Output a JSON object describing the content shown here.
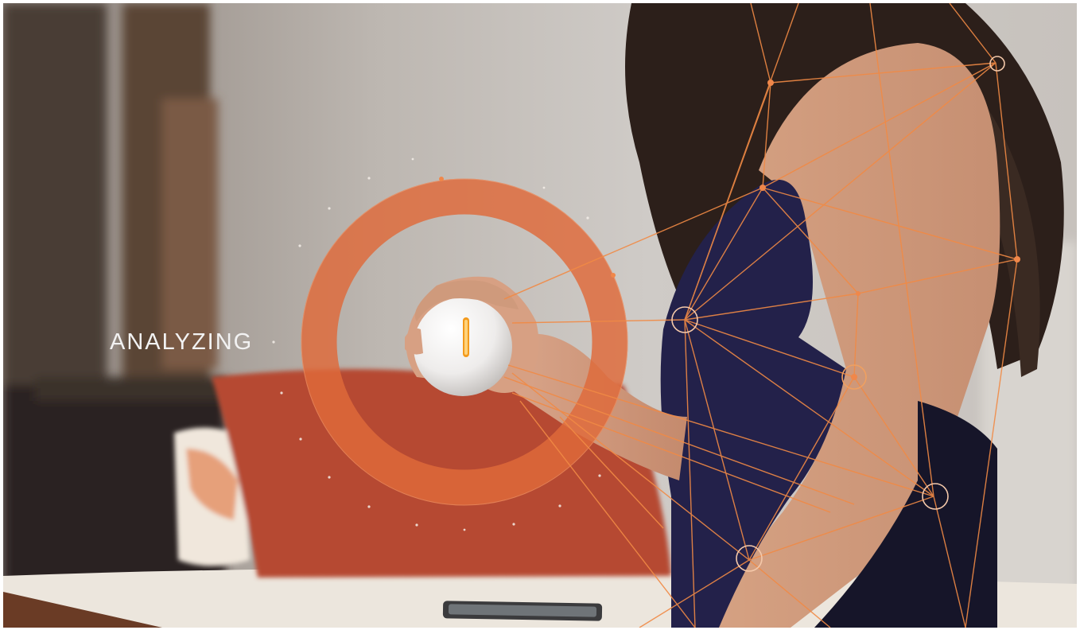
{
  "overlay": {
    "status_label": "ANALYZING"
  },
  "colors": {
    "accent": "#e8743b",
    "ring": "#e06a3a",
    "indicator": "#f39a1c",
    "tank_top": "#23214a",
    "pillow": "#b64a31"
  }
}
